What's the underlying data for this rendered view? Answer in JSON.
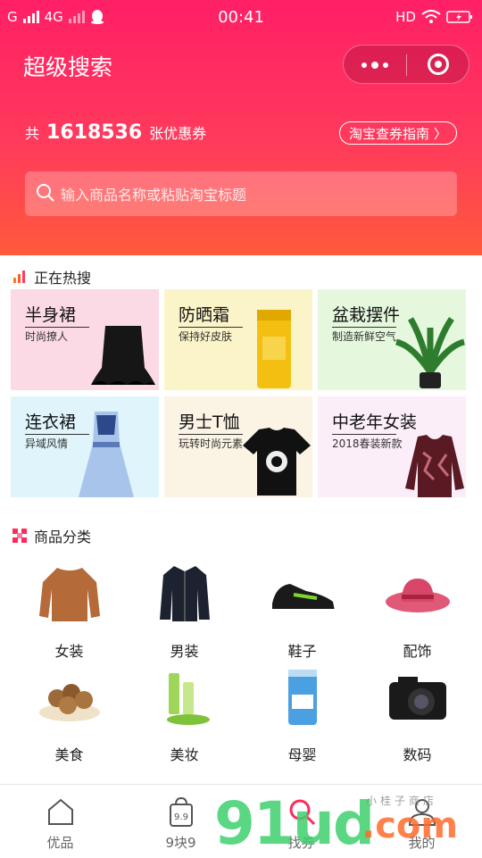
{
  "status_bar": {
    "carrier_left": "G",
    "network": "4G",
    "time": "00:41",
    "hd": "HD"
  },
  "header": {
    "title": "超级搜索",
    "count_prefix": "共",
    "count": "1618536",
    "count_suffix": "张优惠券",
    "guide_label": "淘宝查券指南 〉",
    "search_placeholder": "输入商品名称或粘贴淘宝标题"
  },
  "hot": {
    "title": "正在热搜",
    "items": [
      {
        "title": "半身裙",
        "sub": "时尚撩人",
        "bg": "#fbd9e5"
      },
      {
        "title": "防晒霜",
        "sub": "保持好皮肤",
        "bg": "#fbf4c9"
      },
      {
        "title": "盆栽摆件",
        "sub": "制造新鲜空气",
        "bg": "#e5f8dd"
      },
      {
        "title": "连衣裙",
        "sub": "异域风情",
        "bg": "#dff4fb"
      },
      {
        "title": "男士T恤",
        "sub": "玩转时尚元素",
        "bg": "#fbf3e4"
      },
      {
        "title": "中老年女装",
        "sub": "2018春装新款",
        "bg": "#fbeef8"
      }
    ]
  },
  "categories": {
    "title": "商品分类",
    "items": [
      {
        "label": "女装",
        "icon": "sweater-icon"
      },
      {
        "label": "男装",
        "icon": "coat-icon"
      },
      {
        "label": "鞋子",
        "icon": "sneaker-icon"
      },
      {
        "label": "配饰",
        "icon": "hat-icon"
      },
      {
        "label": "美食",
        "icon": "nuts-icon"
      },
      {
        "label": "美妆",
        "icon": "cosmetics-icon"
      },
      {
        "label": "母婴",
        "icon": "milk-powder-icon"
      },
      {
        "label": "数码",
        "icon": "camera-icon"
      }
    ]
  },
  "tabbar": {
    "items": [
      {
        "label": "优品",
        "icon": "home-icon"
      },
      {
        "label": "9块9",
        "icon": "bag-icon"
      },
      {
        "label": "找券",
        "icon": "search-icon"
      },
      {
        "label": "我的",
        "icon": "user-icon"
      }
    ]
  },
  "watermark": {
    "text": "91ud",
    "domain": ".com",
    "handwriting": "小桂子商店"
  },
  "colors": {
    "accent": "#ff1f66",
    "gradient_end": "#ff5a3c"
  }
}
